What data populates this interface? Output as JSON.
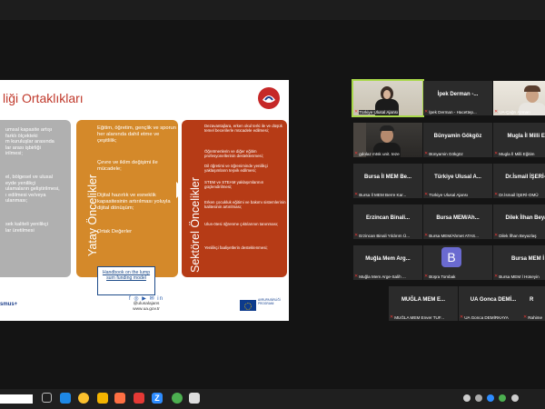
{
  "slide": {
    "title": "liği Ortaklıkları",
    "col1_lines": [
      "umsal kapasite artışı",
      "farklı ölçekteki",
      "m kuruluşlar arasında",
      "lar arası işbirliği",
      "irilmesi;",
      "",
      "el, bölgesel ve ulusal",
      "eyde yenilikçi",
      "ulamaların geliştirilmesi,",
      "ı edilmesi ve/veya",
      "ulanması;",
      "",
      "sek kaliteli yenilikçi",
      "lar üretilmesi"
    ],
    "col2_vertical": "Yatay Öncelikler",
    "col2_items": [
      "Eğitim, öğretim, gençlik ve sporun her alanında dahil etme ve çeşitlilik;",
      "Çevre ve iklim değişimi ile mücadele;",
      "Dijital hazırlık ve esneklik kapasitesinin artırılması yoluyla dijital dönüşüm;",
      "Ortak Değerler"
    ],
    "col3_vertical": "Sektörel Öncelikler",
    "col3_items": [
      "Dezavantajlara, erken okul terki ile ve düşük temel becerilerle mücadele edilmesi;",
      "Öğretmenlerin ve diğer eğitim profesyonellerinin desteklenmesi;",
      "Dil öğretimi ve öğreniminde yenilikçi yaklaşımların teşvik edilmesi;",
      "STEM ve STEAM yaklaşımlarının güçlendirilmesi;",
      "Erken çocukluk eğitimi ve bakımı sistemlerinin kalitesinin artırılması;",
      "Ulus-ötesi öğrenme çıktılarının tanınması;",
      "Yenilikçi faaliyetlerin desteklenmesi;"
    ],
    "handbook": "Handbook on the lump sum funding model",
    "footer_left": "smus+",
    "social_handle": "@ulusalajans",
    "social_url": "www.ua.gov.tr",
    "eu_text": "AVRUPA BİRLİĞİ PROGRAMI"
  },
  "participants": [
    {
      "name": "",
      "label": "Türkiye Ulusal Ajansı",
      "video": true
    },
    {
      "name": "İpek Derman -...",
      "label": "İpek Derman - Hacettep..."
    },
    {
      "name": "",
      "label": "UA-Çağrı Azman",
      "video": true
    },
    {
      "name": "",
      "label": "gdolaz mtsk unit. teze",
      "video": true
    },
    {
      "name": "Bünyamin Gökgöz",
      "label": "Bünyamin Gökgöz"
    },
    {
      "name": "Mugla İl Milli Eğ",
      "label": "Mugla İl Milli Eğitim"
    },
    {
      "name": "Bursa İl MEM Be...",
      "label": "Bursa İl MEM Berre Kar..."
    },
    {
      "name": "Türkiye Ulusal A...",
      "label": "Türkiye Ulusal Ajansı"
    },
    {
      "name": "Dr.İsmail İŞERİ-...",
      "label": "Dr.İsmail İŞERİ-OMÜ"
    },
    {
      "name": "Erzincan Binali...",
      "label": "Erzincan Binali Yıldırım Ü..."
    },
    {
      "name": "Bursa MEM/Ah...",
      "label": "Bursa MEM/Ahmet ATAS..."
    },
    {
      "name": "Dilek İlhan Beyaz",
      "label": "Dilek İlhan Beyazlaş"
    },
    {
      "name": "Muğla Mem Arg...",
      "label": "Muğla Mem Arge-Salih ..."
    },
    {
      "name": "B",
      "label": "Büşra Tombak",
      "avatar": true
    },
    {
      "name": "Bursa MEM İ",
      "label": "Bursa MEM İ Hüseyin"
    },
    {
      "name": "MUĞLA MEM E...",
      "label": "MUĞLA MEM Enver TUF..."
    },
    {
      "name": "UA Gonca DEMİ...",
      "label": "UA Gonca DEMİRKAYA"
    },
    {
      "name": "R",
      "label": "Rahime"
    }
  ],
  "taskbar": {
    "icons": [
      "task-view-icon",
      "edge-icon",
      "chrome-icon",
      "explorer-icon",
      "firefox-icon",
      "opera-icon",
      "zoom-icon",
      "chrome-icon-2",
      "app-icon"
    ],
    "tray_icons": [
      "monitor-icon",
      "bluetooth-icon",
      "zoom-tray-icon",
      "security-icon",
      "wifi-icon"
    ]
  }
}
